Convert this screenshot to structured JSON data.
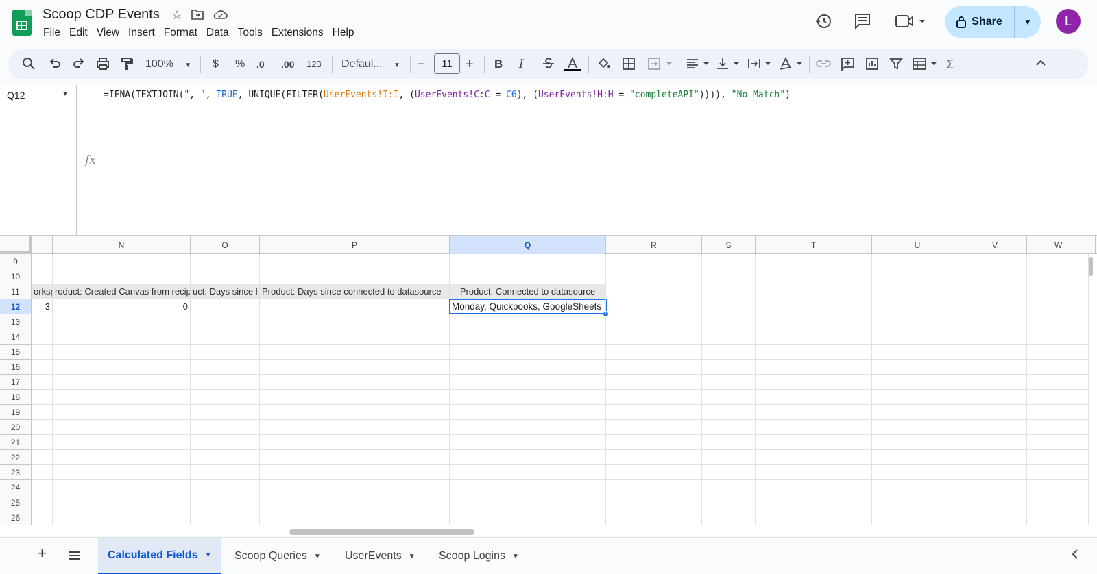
{
  "title": {
    "doc_name": "Scoop CDP Events",
    "menu": [
      "File",
      "Edit",
      "View",
      "Insert",
      "Format",
      "Data",
      "Tools",
      "Extensions",
      "Help"
    ],
    "share_label": "Share",
    "avatar_initial": "L"
  },
  "toolbar": {
    "zoom": "100%",
    "currency": "$",
    "percent": "%",
    "dec_decrease": ".0",
    "dec_increase": ".00",
    "number_format": "123",
    "font": "Defaul...",
    "font_size": "11",
    "bold": "B",
    "italic": "I"
  },
  "formula_bar": {
    "cell_ref": "Q12",
    "fx": "fx",
    "parts": [
      {
        "t": "=IFNA(TEXTJOIN(\", \", ",
        "c": ""
      },
      {
        "t": "TRUE",
        "c": "f-num"
      },
      {
        "t": ", UNIQUE(FILTER(",
        "c": ""
      },
      {
        "t": "UserEvents!I:I",
        "c": "f-orange"
      },
      {
        "t": ", (",
        "c": ""
      },
      {
        "t": "UserEvents!C:C",
        "c": "f-purple"
      },
      {
        "t": " = ",
        "c": ""
      },
      {
        "t": "C6",
        "c": "f-blue"
      },
      {
        "t": "), (",
        "c": ""
      },
      {
        "t": "UserEvents!H:H",
        "c": "f-purple"
      },
      {
        "t": " = ",
        "c": ""
      },
      {
        "t": "\"completeAPI\"",
        "c": "f-green"
      },
      {
        "t": ")))), ",
        "c": ""
      },
      {
        "t": "\"No Match\"",
        "c": "f-green"
      },
      {
        "t": ")",
        "c": ""
      }
    ]
  },
  "grid": {
    "columns": [
      "N",
      "O",
      "P",
      "Q",
      "R",
      "S",
      "T",
      "U",
      "V",
      "W"
    ],
    "selected_column": "Q",
    "rows": [
      "9",
      "10",
      "11",
      "12",
      "13",
      "14",
      "15",
      "16",
      "17",
      "18",
      "19",
      "20",
      "21",
      "22",
      "23",
      "24",
      "25",
      "26"
    ],
    "selected_row": "12",
    "row11": {
      "m": "orksp",
      "n": "roduct: Created Canvas from recip",
      "o": "uct: Days since l",
      "p": "Product: Days since connected to datasource",
      "q": "Product: Connected to datasource"
    },
    "row12": {
      "m": "3",
      "n": "0",
      "q": "Monday, Quickbooks, GoogleSheets"
    }
  },
  "sheets": [
    {
      "name": "Calculated Fields",
      "active": true
    },
    {
      "name": "Scoop Queries",
      "active": false
    },
    {
      "name": "UserEvents",
      "active": false
    },
    {
      "name": "Scoop Logins",
      "active": false
    }
  ],
  "colors": {
    "accent": "#0b57d0",
    "share_bg": "#c2e7ff",
    "avatar": "#8e24aa",
    "sheets_green": "#0f9d58"
  }
}
